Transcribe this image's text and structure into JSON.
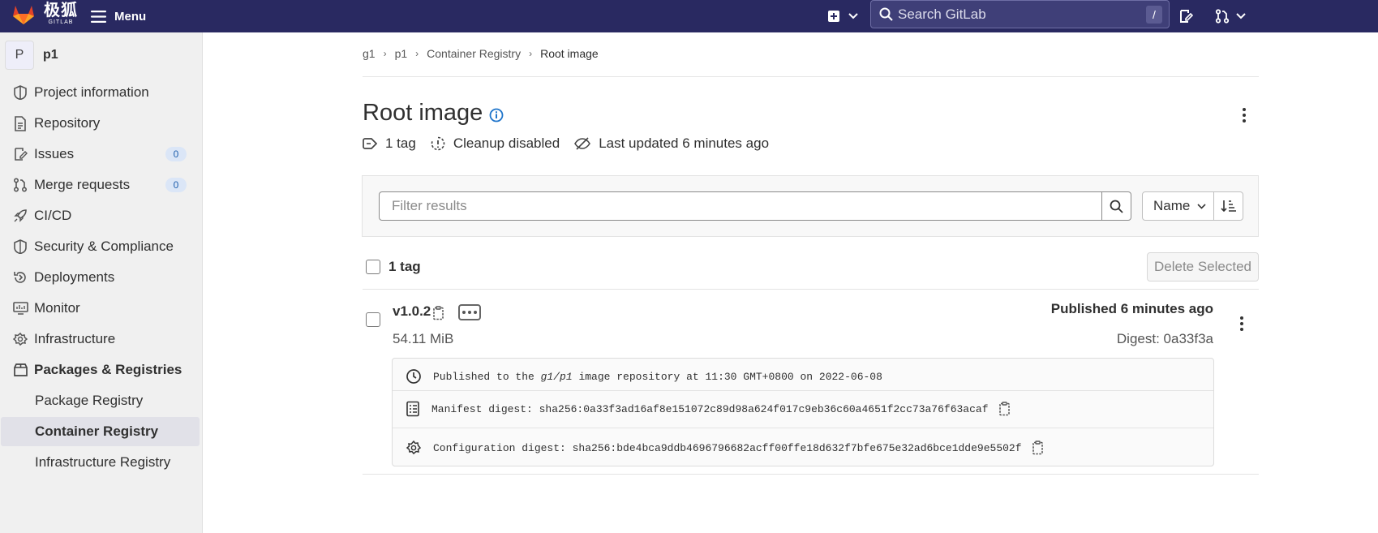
{
  "topbar": {
    "logo_cn": "极狐",
    "logo_en": "GITLAB",
    "menu_label": "Menu",
    "search_placeholder": "Search GitLab",
    "search_shortcut": "/"
  },
  "sidebar": {
    "project_initial": "P",
    "project_name": "p1",
    "items": [
      {
        "label": "Project information",
        "icon": "project-info-icon"
      },
      {
        "label": "Repository",
        "icon": "document-icon"
      },
      {
        "label": "Issues",
        "icon": "issues-icon",
        "badge": "0"
      },
      {
        "label": "Merge requests",
        "icon": "merge-request-icon",
        "badge": "0"
      },
      {
        "label": "CI/CD",
        "icon": "rocket-icon"
      },
      {
        "label": "Security & Compliance",
        "icon": "shield-icon"
      },
      {
        "label": "Deployments",
        "icon": "deployments-icon"
      },
      {
        "label": "Monitor",
        "icon": "monitor-icon"
      },
      {
        "label": "Infrastructure",
        "icon": "cloud-gear-icon"
      },
      {
        "label": "Packages & Registries",
        "icon": "package-icon"
      }
    ],
    "subitems": [
      {
        "label": "Package Registry"
      },
      {
        "label": "Container Registry"
      },
      {
        "label": "Infrastructure Registry"
      }
    ]
  },
  "breadcrumb": [
    "g1",
    "p1",
    "Container Registry",
    "Root image"
  ],
  "page": {
    "title": "Root image",
    "meta": {
      "tags": "1 tag",
      "cleanup": "Cleanup disabled",
      "updated": "Last updated 6 minutes ago"
    }
  },
  "filter": {
    "placeholder": "Filter results",
    "sort_label": "Name"
  },
  "list": {
    "header_count": "1 tag",
    "delete_label": "Delete Selected"
  },
  "tag": {
    "name": "v1.0.2",
    "size": "54.11 MiB",
    "published": "Published 6 minutes ago",
    "digest": "Digest: 0a33f3a",
    "details": {
      "pub_prefix": "Published to the ",
      "pub_repo": "g1/p1",
      "pub_suffix": " image repository at 11:30 GMT+0800 on 2022-06-08",
      "manifest": "Manifest digest: sha256:0a33f3ad16af8e151072c89d98a624f017c9eb36c60a4651f2cc73a76f63acaf",
      "config": "Configuration digest: sha256:bde4bca9ddb4696796682acff00ffe18d632f7bfe675e32ad6bce1dde9e5502f"
    }
  },
  "colors": {
    "topbar": "#292961",
    "accent": "#1f75cb",
    "badge_bg": "#dbe6f7"
  }
}
